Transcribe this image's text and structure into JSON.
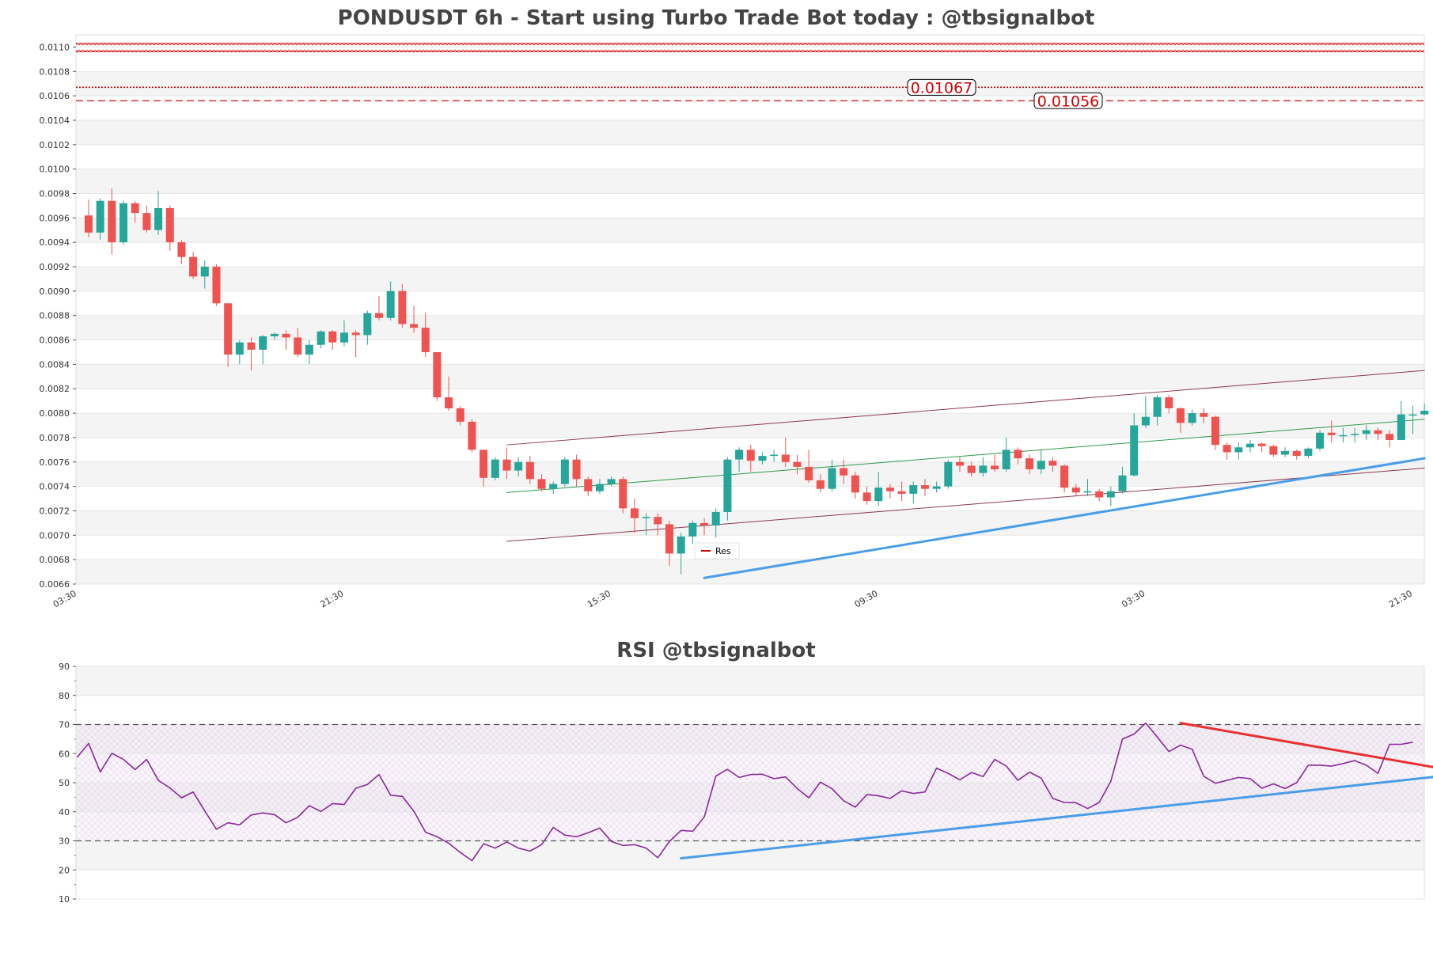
{
  "chart_data": [
    {
      "type": "candlestick",
      "title": "PONDUSDT 6h - Start using Turbo Trade Bot today : @tbsignalbot",
      "ylim": [
        0.0066,
        0.0111
      ],
      "yticks": [
        "0.0066",
        "0.0068",
        "0.0070",
        "0.0072",
        "0.0074",
        "0.0076",
        "0.0078",
        "0.0080",
        "0.0082",
        "0.0084",
        "0.0086",
        "0.0088",
        "0.0090",
        "0.0092",
        "0.0094",
        "0.0096",
        "0.0098",
        "0.0100",
        "0.0102",
        "0.0104",
        "0.0106",
        "0.0108",
        "0.0110"
      ],
      "xticks": [
        {
          "label": "03:30",
          "i": -1
        },
        {
          "label": "21:30",
          "i": 22
        },
        {
          "label": "15:30",
          "i": 45
        },
        {
          "label": "09:30",
          "i": 68
        },
        {
          "label": "03:30",
          "i": 91
        },
        {
          "label": "21:30",
          "i": 114
        }
      ],
      "price_levels": [
        {
          "value": 0.01067,
          "label": "0.01067",
          "style": "dotted",
          "color": "#d00000"
        },
        {
          "value": 0.01056,
          "label": "0.01056",
          "style": "dashed",
          "color": "#d04040"
        }
      ],
      "resistance_band": {
        "from": 0.01096,
        "to": 0.01103,
        "color": "#d00000"
      },
      "legend": [
        {
          "label": "Res",
          "color": "#d00000"
        }
      ],
      "trendlines": [
        {
          "i1": 36,
          "v1": 0.00774,
          "i2": 115,
          "v2": 0.00835,
          "color": "#8b3a4a",
          "width": 1
        },
        {
          "i1": 36,
          "v1": 0.00735,
          "i2": 115,
          "v2": 0.00795,
          "color": "#2e9a4a",
          "width": 1
        },
        {
          "i1": 36,
          "v1": 0.00695,
          "i2": 115,
          "v2": 0.00755,
          "color": "#8b3a4a",
          "width": 1
        },
        {
          "i1": 53,
          "v1": 0.00665,
          "i2": 115,
          "v2": 0.00763,
          "color": "#4a9de8",
          "width": 3
        }
      ],
      "candles": [
        [
          0.00962,
          0.00948,
          0.00975,
          0.00944
        ],
        [
          0.00948,
          0.00974,
          0.00976,
          0.00942
        ],
        [
          0.00974,
          0.0094,
          0.00984,
          0.0093
        ],
        [
          0.0094,
          0.00972,
          0.00974,
          0.00938
        ],
        [
          0.00972,
          0.00964,
          0.00974,
          0.00956
        ],
        [
          0.00964,
          0.0095,
          0.0097,
          0.00948
        ],
        [
          0.0095,
          0.00968,
          0.00982,
          0.00946
        ],
        [
          0.00968,
          0.0094,
          0.0097,
          0.00933
        ],
        [
          0.0094,
          0.00928,
          0.00942,
          0.00922
        ],
        [
          0.00928,
          0.00912,
          0.00932,
          0.0091
        ],
        [
          0.00912,
          0.0092,
          0.00925,
          0.00902
        ],
        [
          0.0092,
          0.0089,
          0.00922,
          0.00888
        ],
        [
          0.0089,
          0.00848,
          0.0089,
          0.00838
        ],
        [
          0.00848,
          0.00858,
          0.0086,
          0.0084
        ],
        [
          0.00858,
          0.00852,
          0.00862,
          0.00835
        ],
        [
          0.00852,
          0.00863,
          0.00864,
          0.0084
        ],
        [
          0.00863,
          0.00865,
          0.00866,
          0.0086
        ],
        [
          0.00865,
          0.00862,
          0.00868,
          0.00852
        ],
        [
          0.00862,
          0.00848,
          0.0087,
          0.00846
        ],
        [
          0.00848,
          0.00856,
          0.0086,
          0.0084
        ],
        [
          0.00856,
          0.00867,
          0.00868,
          0.00853
        ],
        [
          0.00867,
          0.00858,
          0.00868,
          0.00852
        ],
        [
          0.00858,
          0.00866,
          0.00876,
          0.00855
        ],
        [
          0.00866,
          0.00864,
          0.00868,
          0.00846
        ],
        [
          0.00864,
          0.00882,
          0.00884,
          0.00856
        ],
        [
          0.00882,
          0.00878,
          0.00896,
          0.00876
        ],
        [
          0.00878,
          0.009,
          0.00908,
          0.00876
        ],
        [
          0.009,
          0.00873,
          0.00906,
          0.0087
        ],
        [
          0.00873,
          0.0087,
          0.00888,
          0.00866
        ],
        [
          0.0087,
          0.0085,
          0.00882,
          0.00846
        ],
        [
          0.0085,
          0.00813,
          0.0085,
          0.0081
        ],
        [
          0.00813,
          0.00804,
          0.0083,
          0.00802
        ],
        [
          0.00804,
          0.00793,
          0.00806,
          0.0079
        ],
        [
          0.00793,
          0.0077,
          0.00795,
          0.00768
        ],
        [
          0.0077,
          0.00747,
          0.0077,
          0.0074
        ],
        [
          0.00747,
          0.00762,
          0.00764,
          0.00745
        ],
        [
          0.00762,
          0.00753,
          0.00772,
          0.00746
        ],
        [
          0.00753,
          0.0076,
          0.00764,
          0.00748
        ],
        [
          0.0076,
          0.00746,
          0.00765,
          0.00742
        ],
        [
          0.00746,
          0.00738,
          0.0075,
          0.00736
        ],
        [
          0.00738,
          0.00742,
          0.00744,
          0.00734
        ],
        [
          0.00742,
          0.00762,
          0.00764,
          0.0074
        ],
        [
          0.00762,
          0.00746,
          0.00766,
          0.0074
        ],
        [
          0.00746,
          0.00736,
          0.00748,
          0.00732
        ],
        [
          0.00736,
          0.00742,
          0.00746,
          0.00734
        ],
        [
          0.00742,
          0.00746,
          0.00748,
          0.0074
        ],
        [
          0.00746,
          0.00722,
          0.00748,
          0.00718
        ],
        [
          0.00722,
          0.00714,
          0.0073,
          0.00702
        ],
        [
          0.00714,
          0.00715,
          0.00718,
          0.007
        ],
        [
          0.00715,
          0.00709,
          0.00718,
          0.007
        ],
        [
          0.00709,
          0.00685,
          0.00712,
          0.00675
        ],
        [
          0.00685,
          0.00699,
          0.00702,
          0.00668
        ],
        [
          0.00699,
          0.0071,
          0.00712,
          0.00693
        ],
        [
          0.0071,
          0.00708,
          0.00714,
          0.007
        ],
        [
          0.00708,
          0.00719,
          0.00722,
          0.00698
        ],
        [
          0.00719,
          0.00762,
          0.00764,
          0.00712
        ],
        [
          0.00762,
          0.0077,
          0.00772,
          0.00752
        ],
        [
          0.0077,
          0.00761,
          0.00774,
          0.00752
        ],
        [
          0.00761,
          0.00765,
          0.00768,
          0.00758
        ],
        [
          0.00765,
          0.00766,
          0.0077,
          0.0076
        ],
        [
          0.00766,
          0.0076,
          0.0078,
          0.00756
        ],
        [
          0.0076,
          0.00756,
          0.00766,
          0.0075
        ],
        [
          0.00756,
          0.00745,
          0.0077,
          0.00743
        ],
        [
          0.00745,
          0.00738,
          0.0075,
          0.00735
        ],
        [
          0.00738,
          0.00755,
          0.00762,
          0.00736
        ],
        [
          0.00755,
          0.00749,
          0.00762,
          0.00742
        ],
        [
          0.00749,
          0.00735,
          0.00752,
          0.0073
        ],
        [
          0.00735,
          0.00728,
          0.0074,
          0.00725
        ],
        [
          0.00728,
          0.00739,
          0.00752,
          0.00724
        ],
        [
          0.00739,
          0.00736,
          0.00742,
          0.0073
        ],
        [
          0.00736,
          0.00734,
          0.00744,
          0.00728
        ],
        [
          0.00734,
          0.00741,
          0.00744,
          0.00726
        ],
        [
          0.00741,
          0.00738,
          0.00746,
          0.00732
        ],
        [
          0.00738,
          0.0074,
          0.00744,
          0.00735
        ],
        [
          0.0074,
          0.0076,
          0.00762,
          0.00738
        ],
        [
          0.0076,
          0.00757,
          0.00764,
          0.00752
        ],
        [
          0.00757,
          0.00751,
          0.0076,
          0.00748
        ],
        [
          0.00751,
          0.00757,
          0.00764,
          0.00748
        ],
        [
          0.00757,
          0.00754,
          0.00766,
          0.00752
        ],
        [
          0.00754,
          0.0077,
          0.0078,
          0.00752
        ],
        [
          0.0077,
          0.00763,
          0.00772,
          0.00758
        ],
        [
          0.00763,
          0.00754,
          0.00766,
          0.0075
        ],
        [
          0.00754,
          0.00761,
          0.0077,
          0.0075
        ],
        [
          0.00761,
          0.00757,
          0.00764,
          0.00752
        ],
        [
          0.00757,
          0.00739,
          0.00758,
          0.00735
        ],
        [
          0.00739,
          0.00735,
          0.00742,
          0.00732
        ],
        [
          0.00735,
          0.00736,
          0.00746,
          0.00732
        ],
        [
          0.00736,
          0.00731,
          0.00738,
          0.00728
        ],
        [
          0.00731,
          0.00736,
          0.0074,
          0.00724
        ],
        [
          0.00736,
          0.00749,
          0.00756,
          0.00734
        ],
        [
          0.00749,
          0.0079,
          0.008,
          0.00748
        ],
        [
          0.0079,
          0.00797,
          0.00814,
          0.00788
        ],
        [
          0.00797,
          0.00813,
          0.00815,
          0.0079
        ],
        [
          0.00813,
          0.00804,
          0.00815,
          0.008
        ],
        [
          0.00804,
          0.00792,
          0.00805,
          0.00784
        ],
        [
          0.00792,
          0.008,
          0.00803,
          0.0079
        ],
        [
          0.008,
          0.00797,
          0.00804,
          0.00792
        ],
        [
          0.00797,
          0.00774,
          0.00798,
          0.0077
        ],
        [
          0.00774,
          0.00768,
          0.00776,
          0.00762
        ],
        [
          0.00768,
          0.00772,
          0.00776,
          0.00762
        ],
        [
          0.00772,
          0.00775,
          0.00778,
          0.00768
        ],
        [
          0.00775,
          0.00773,
          0.00776,
          0.00768
        ],
        [
          0.00773,
          0.00766,
          0.00774,
          0.00764
        ],
        [
          0.00766,
          0.00769,
          0.00772,
          0.00764
        ],
        [
          0.00769,
          0.00765,
          0.0077,
          0.00762
        ],
        [
          0.00765,
          0.00771,
          0.00772,
          0.00763
        ],
        [
          0.00771,
          0.00784,
          0.00786,
          0.00769
        ],
        [
          0.00784,
          0.00782,
          0.00794,
          0.00776
        ],
        [
          0.00782,
          0.00782,
          0.00788,
          0.00776
        ],
        [
          0.00782,
          0.00783,
          0.00788,
          0.00776
        ],
        [
          0.00783,
          0.00786,
          0.0079,
          0.00778
        ],
        [
          0.00786,
          0.00783,
          0.00788,
          0.00778
        ],
        [
          0.00783,
          0.00778,
          0.00786,
          0.00772
        ],
        [
          0.00778,
          0.00799,
          0.0081,
          0.00778
        ],
        [
          0.00799,
          0.00799,
          0.00806,
          0.00783
        ],
        [
          0.00799,
          0.00802,
          0.00808,
          0.00798
        ]
      ]
    },
    {
      "type": "line",
      "title": "RSI @tbsignalbot",
      "ylim": [
        10,
        90
      ],
      "yticks": [
        "10",
        "20",
        "30",
        "40",
        "50",
        "60",
        "70",
        "80",
        "90"
      ],
      "reference_lines": [
        30,
        70
      ],
      "trendlines": [
        {
          "i1": 51,
          "v1": 24,
          "i2": 117,
          "v2": 52.5,
          "color": "#4a9de8",
          "width": 3
        },
        {
          "i1": 94,
          "v1": 70.5,
          "i2": 117,
          "v2": 54.5,
          "color": "#e83030",
          "width": 3
        }
      ],
      "series": [
        {
          "color": "#8b2a9b",
          "values": [
            58.7,
            63.5,
            53.7,
            60.1,
            58,
            54.5,
            58,
            50.8,
            48.2,
            44.8,
            46.8,
            40.3,
            34,
            36.2,
            35.5,
            38.9,
            39.6,
            39,
            36.2,
            38.1,
            42.1,
            40.1,
            42.8,
            42.5,
            48.1,
            49.4,
            52.8,
            45.7,
            45.3,
            40.2,
            33,
            31.4,
            29.2,
            26,
            23.2,
            29,
            27.5,
            29.6,
            27.5,
            26.5,
            28.7,
            34.6,
            32,
            31.4,
            32.8,
            34.4,
            29.8,
            28.4,
            28.7,
            27.5,
            24.2,
            29.8,
            33.6,
            33.3,
            38.2,
            52.3,
            54.6,
            51.8,
            52.8,
            52.9,
            51.4,
            52,
            48,
            44.8,
            50.2,
            47.9,
            43.8,
            41.6,
            45.9,
            45.5,
            44.6,
            47.2,
            46.3,
            46.8,
            55,
            53.2,
            51,
            53.5,
            52.1,
            58,
            55.7,
            50.8,
            53.6,
            51.6,
            44.6,
            43.2,
            43.1,
            41.1,
            43.2,
            50.5,
            65,
            66.7,
            70.5,
            65.7,
            60.7,
            62.9,
            61.5,
            52.2,
            49.8,
            50.8,
            51.8,
            51.4,
            48.1,
            49.6,
            48,
            50,
            56,
            56,
            55.7,
            56.6,
            57.6,
            56,
            53.2,
            63.2,
            63.2,
            63.9
          ]
        }
      ]
    }
  ]
}
